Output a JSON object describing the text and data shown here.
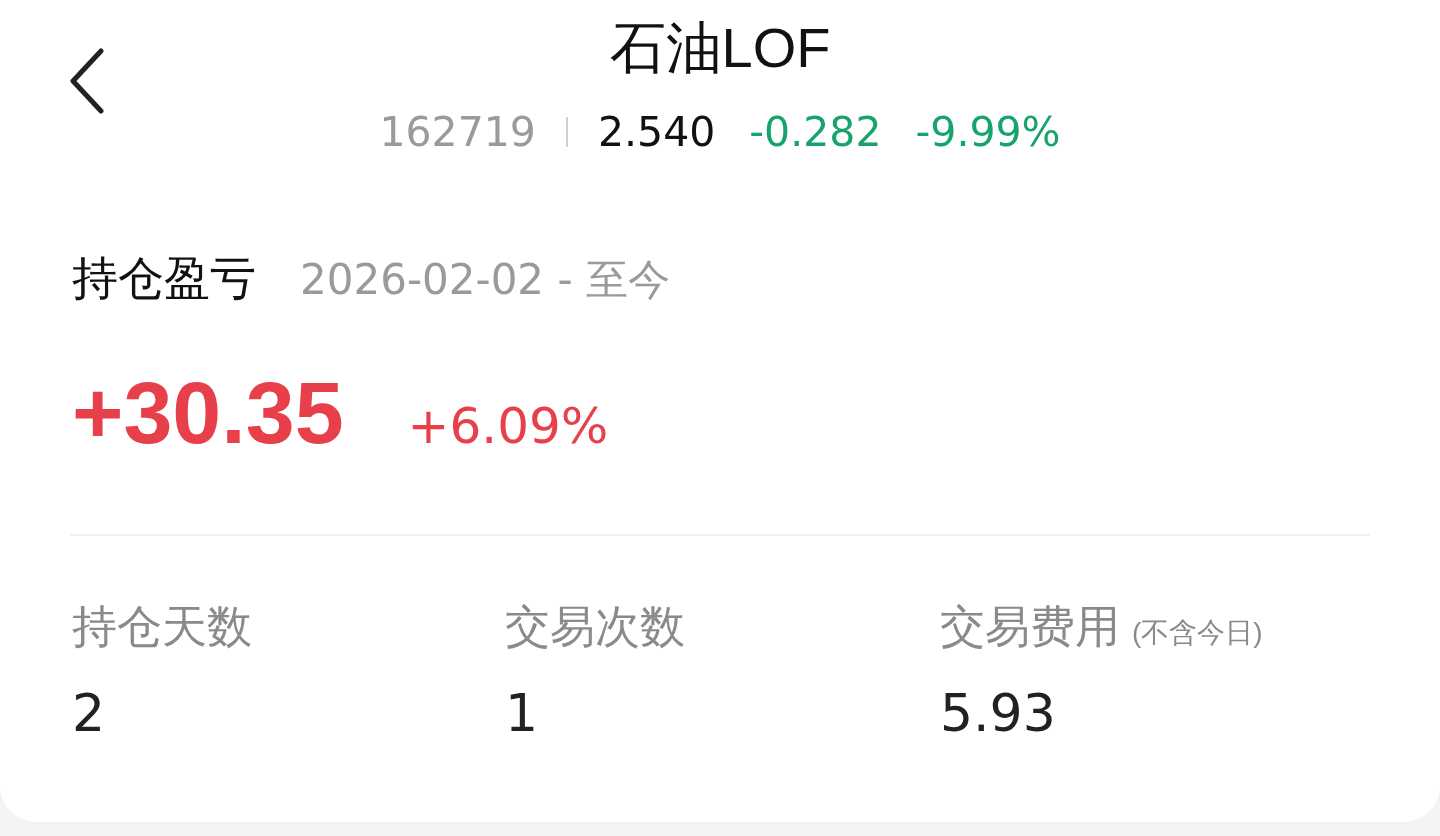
{
  "header": {
    "title": "石油LOF",
    "code": "162719",
    "price": "2.540",
    "change": "-0.282",
    "change_pct": "-9.99%",
    "rising": false
  },
  "profit": {
    "label": "持仓盈亏",
    "period": "2026-02-02 - 至今",
    "amount": "+30.35",
    "percent": "+6.09%",
    "rising": true
  },
  "stats": [
    {
      "label": "持仓天数",
      "value": "2"
    },
    {
      "label": "交易次数",
      "value": "1"
    },
    {
      "label": "交易费用",
      "note": "(不含今日)",
      "value": "5.93"
    }
  ]
}
